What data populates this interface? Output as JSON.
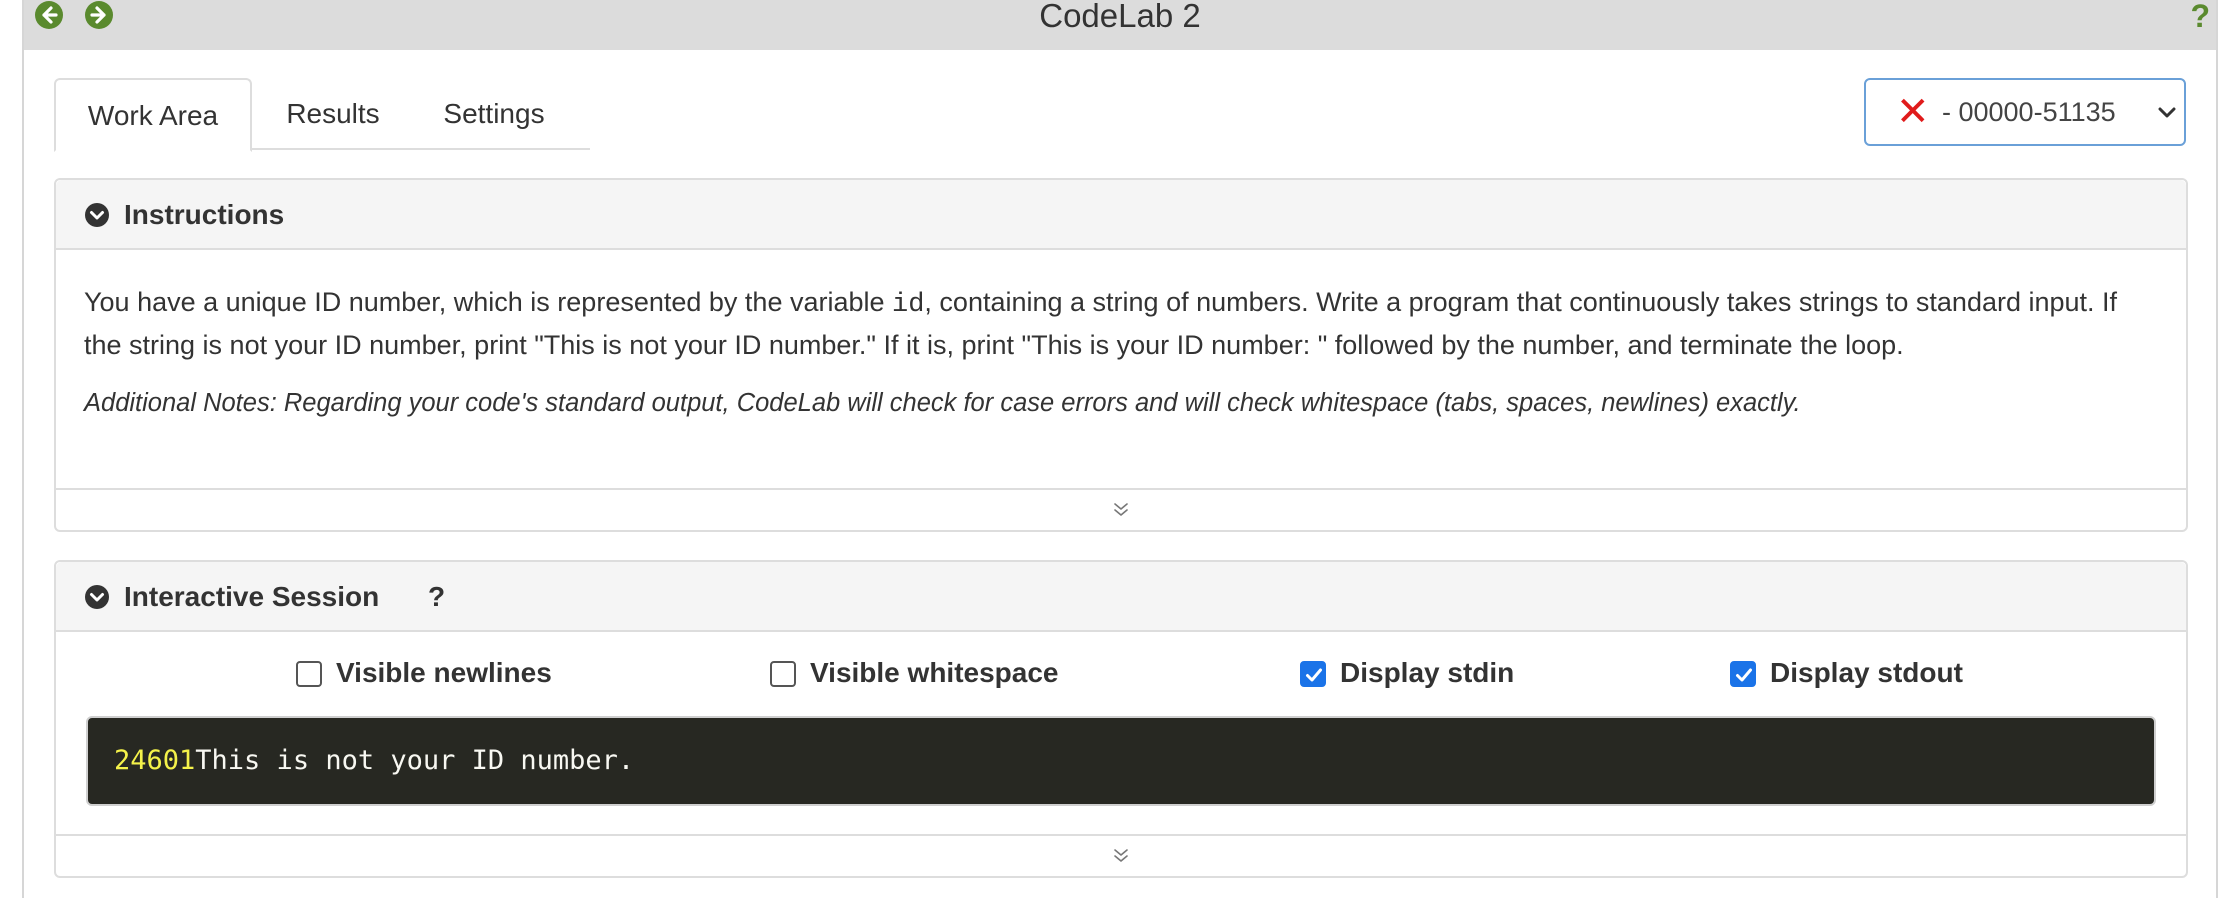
{
  "window": {
    "title": "CodeLab 2",
    "help": "?"
  },
  "tabs": [
    {
      "label": "Work Area",
      "active": true
    },
    {
      "label": "Results",
      "active": false
    },
    {
      "label": "Settings",
      "active": false
    }
  ],
  "attempt_select": {
    "status_icon": "x-mark-icon",
    "value": "- 00000-51135"
  },
  "instructions": {
    "heading": "Instructions",
    "text_before_code": "You have a unique ID number, which is represented by the variable ",
    "code": "id",
    "text_after_code": ", containing a string of numbers. Write a program that continuously takes strings to standard input. If the string is not your ID number, print \"This is not your ID number.\" If it is, print \"This is your ID number: \" followed by the number, and terminate the loop.",
    "notes": "Additional Notes: Regarding your code's standard output, CodeLab will check for case errors and will check whitespace (tabs, spaces, newlines) exactly."
  },
  "session": {
    "heading": "Interactive Session",
    "help": "?",
    "options": [
      {
        "label": "Visible newlines",
        "checked": false
      },
      {
        "label": "Visible whitespace",
        "checked": false
      },
      {
        "label": "Display stdin",
        "checked": true
      },
      {
        "label": "Display stdout",
        "checked": true
      }
    ],
    "stdin": "24601",
    "stdout": "This is not your ID number."
  },
  "colors": {
    "titlebar": "#dcdcdc",
    "nav_icon": "#5a8a2e",
    "error_x": "#e01b1b",
    "checkbox": "#1a73e8",
    "terminal_bg": "#272822",
    "stdin_text": "#f4f24a",
    "stdout_text": "#f8f8f2"
  }
}
